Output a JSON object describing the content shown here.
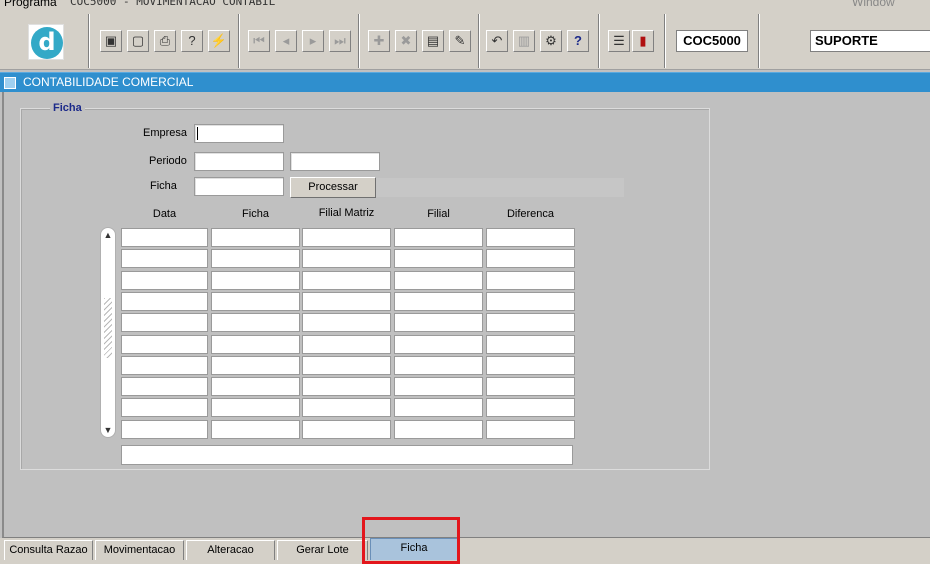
{
  "menubar": {
    "programa": "Programa",
    "title": "COC5000 - MOVIMENTACAO CONTABIL",
    "window": "Window"
  },
  "toolbar": {
    "logo": "d",
    "buttons": [
      {
        "name": "save-icon",
        "glyph": "▣"
      },
      {
        "name": "print-preview-icon",
        "glyph": "▢"
      },
      {
        "name": "print-icon",
        "glyph": "⎙"
      },
      {
        "name": "query-icon",
        "glyph": "?"
      },
      {
        "name": "execute-query-icon",
        "glyph": "⚡"
      },
      {
        "name": "first-record-icon",
        "glyph": "⏮"
      },
      {
        "name": "previous-record-icon",
        "glyph": "◂"
      },
      {
        "name": "next-record-icon",
        "glyph": "▸"
      },
      {
        "name": "last-record-icon",
        "glyph": "⏭"
      },
      {
        "name": "insert-record-icon",
        "glyph": "✚"
      },
      {
        "name": "delete-record-icon",
        "glyph": "✖"
      },
      {
        "name": "clear-record-icon",
        "glyph": "▤"
      },
      {
        "name": "edit-icon",
        "glyph": "✎"
      },
      {
        "name": "undo-icon",
        "glyph": "↶"
      },
      {
        "name": "clipboard-icon",
        "glyph": "▥"
      },
      {
        "name": "tools-icon",
        "glyph": "⚙"
      },
      {
        "name": "help-icon",
        "glyph": "?"
      },
      {
        "name": "menu-icon",
        "glyph": "☰"
      },
      {
        "name": "exit-icon",
        "glyph": "▮"
      }
    ],
    "program_code": "COC5000",
    "user": "SUPORTE"
  },
  "window_title": "CONTABILIDADE COMERCIAL",
  "form": {
    "frame_title": "Ficha",
    "empresa_label": "Empresa",
    "periodo_label": "Periodo",
    "ficha_label": "Ficha",
    "empresa_value": "",
    "periodo_start": "",
    "periodo_end": "",
    "ficha_value": "",
    "processar_label": "Processar"
  },
  "table": {
    "columns": [
      "Data",
      "Ficha",
      "Filial Matriz",
      "Filial",
      "Diferenca"
    ],
    "row_count": 10,
    "footer_value": ""
  },
  "tabs": [
    {
      "label": "Consulta Razao",
      "active": false
    },
    {
      "label": "Movimentacao",
      "active": false
    },
    {
      "label": "Alteracao",
      "active": false
    },
    {
      "label": "Gerar Lote",
      "active": false
    },
    {
      "label": "Ficha",
      "active": true
    }
  ],
  "colors": {
    "title_bar": "#2f8fce",
    "active_tab": "#a9c3dc",
    "highlight": "#e3161c",
    "frame_title": "#1c2a8a"
  }
}
